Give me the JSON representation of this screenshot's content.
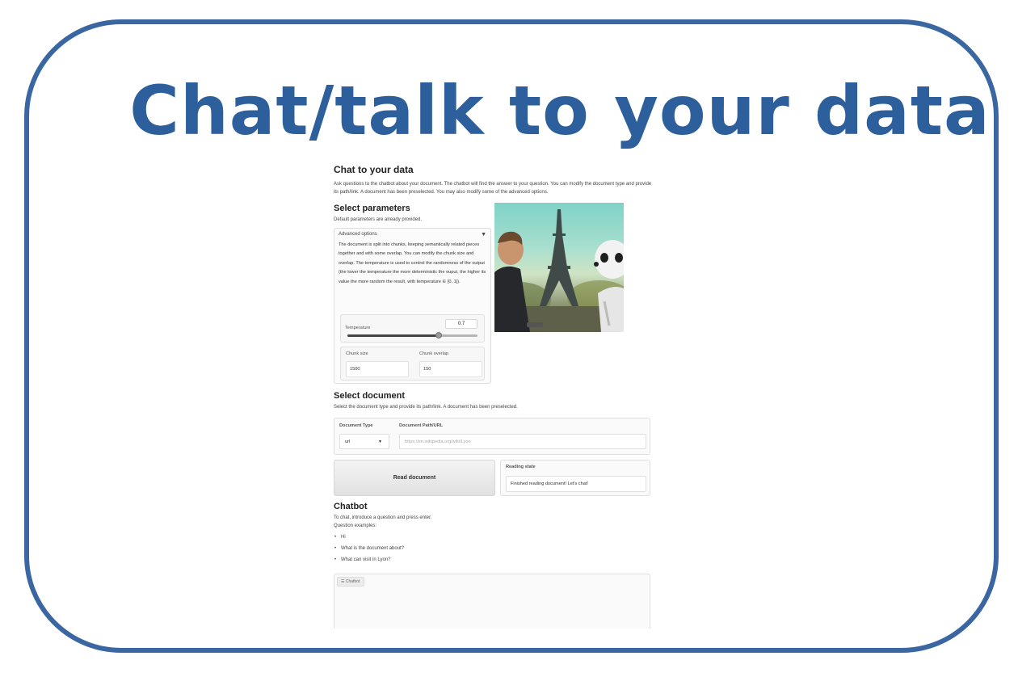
{
  "slide": {
    "title": "Chat/talk to your data"
  },
  "app": {
    "title": "Chat to your data",
    "intro": "Ask questions to the chatbot about your document. The chatbot will find the answer to your question. You can modify the document type and provide its path/link. A document has been preselected. You may also modify some of the advanced options.",
    "params": {
      "heading": "Select parameters",
      "subtitle": "Default parameters are already provided.",
      "advanced_label": "Advanced options",
      "advanced_caret": "▼",
      "description": "The document is split into chunks, keeping semantically related pieces together and with some overlap. You can modify the chunk size and overlap. The temperature is used to control the randomness of the output (the lower the temperature the more deterministic the ouput, the higher its value the more random the result, with temperature ∈ [0, 1]).",
      "temperature_label": "Temperature",
      "temperature_value": "0.7",
      "temperature_fraction": 0.7,
      "chunk_size_label": "Chunk size",
      "chunk_size_value": "1500",
      "chunk_overlap_label": "Chunk overlap",
      "chunk_overlap_value": "150"
    },
    "document": {
      "heading": "Select document",
      "subtitle": "Select the document type and provide its path/link. A document has been preselected.",
      "type_label": "Document Type",
      "type_value": "url",
      "type_chevron": "▼",
      "path_label": "Document Path/URL",
      "path_placeholder": "https://en.wikipedia.org/wiki/Lyon",
      "read_button": "Read document",
      "reading_label": "Reading state",
      "reading_value": "Finished reading document! Let's chat!"
    },
    "chatbot": {
      "heading": "Chatbot",
      "instructions": "To chat, introduce a question and press enter.",
      "examples_label": "Question examples:",
      "examples": [
        "Hi",
        "What is the document about?",
        "What can visit in Lyon?"
      ],
      "chat_tag": "Chatbot",
      "chat_tag_icon": "chat-icon"
    }
  },
  "colors": {
    "frame_border": "#3a67a2",
    "title": "#2d5f9c"
  }
}
